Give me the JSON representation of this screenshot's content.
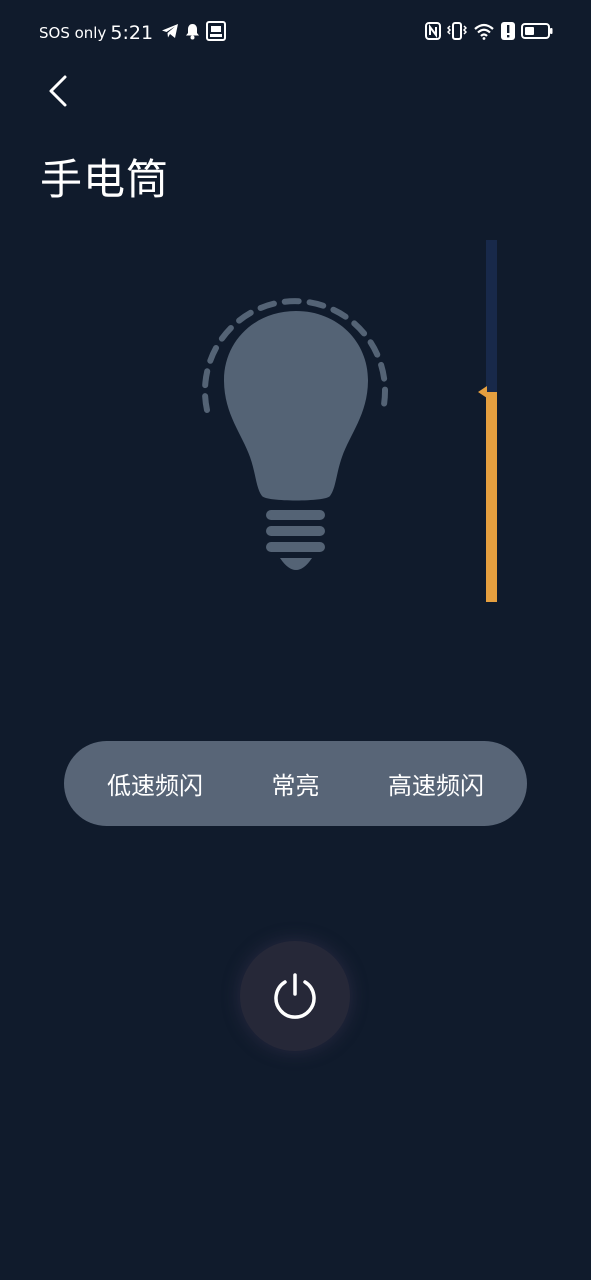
{
  "status_bar": {
    "carrier": "SOS only",
    "time": "5:21",
    "left_icons": [
      "telegram-icon",
      "bell-icon",
      "app-notification-icon"
    ],
    "right_icons": [
      "nfc-icon",
      "vibrate-icon",
      "wifi-icon",
      "alert-icon",
      "battery-icon"
    ]
  },
  "header": {
    "back_icon": "chevron-left-icon",
    "title": "手电筒"
  },
  "flashlight": {
    "bulb_icon": "lightbulb-icon",
    "brightness_level": 0.58
  },
  "modes": [
    {
      "label": "低速频闪"
    },
    {
      "label": "常亮"
    },
    {
      "label": "高速频闪"
    }
  ],
  "power": {
    "icon": "power-icon"
  },
  "colors": {
    "background": "#101b2c",
    "bulb": "#546375",
    "slider_track": "#18294a",
    "slider_fill": "#e59f3f",
    "mode_pill": "#586577",
    "power_button": "#262838"
  }
}
